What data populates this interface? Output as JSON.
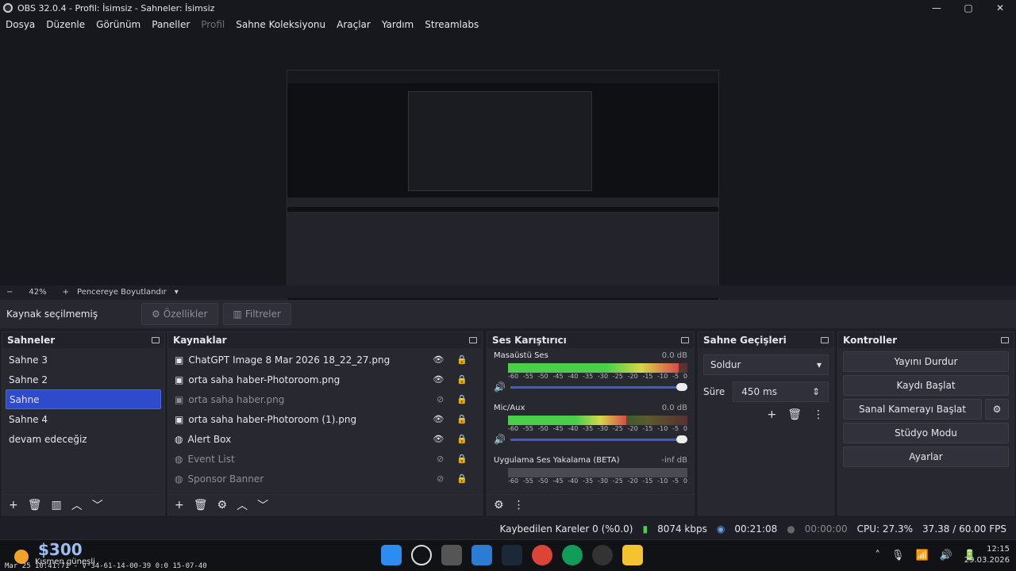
{
  "window": {
    "title": "OBS 32.0.4 - Profil: İsimsiz - Sahneler: İsimsiz",
    "controls": [
      "—",
      "▢",
      "✕"
    ]
  },
  "menu": [
    {
      "label": "Dosya",
      "enabled": true
    },
    {
      "label": "Düzenle",
      "enabled": true
    },
    {
      "label": "Görünüm",
      "enabled": true
    },
    {
      "label": "Paneller",
      "enabled": true
    },
    {
      "label": "Profil",
      "enabled": false
    },
    {
      "label": "Sahne Koleksiyonu",
      "enabled": true
    },
    {
      "label": "Araçlar",
      "enabled": true
    },
    {
      "label": "Yardım",
      "enabled": true
    },
    {
      "label": "Streamlabs",
      "enabled": true
    }
  ],
  "zoom": {
    "minus": "−",
    "value": "42%",
    "plus": "+",
    "fit_label": "Pencereye Boyutlandır"
  },
  "source_bar": {
    "label": "Kaynak seçilmemiş",
    "properties": "Özellikler",
    "filters": "Filtreler"
  },
  "scenes": {
    "title": "Sahneler",
    "items": [
      "Sahne 3",
      "Sahne 2",
      "Sahne",
      "Sahne 4",
      "devam edeceğiz"
    ],
    "selected": 2
  },
  "sources": {
    "title": "Kaynaklar",
    "items": [
      {
        "name": "ChatGPT Image 8 Mar 2026 18_22_27.png",
        "visible": true
      },
      {
        "name": "orta saha haber-Photoroom.png",
        "visible": true
      },
      {
        "name": "orta saha haber.png",
        "visible": false
      },
      {
        "name": "orta saha haber-Photoroom (1).png",
        "visible": true
      },
      {
        "name": "Alert Box",
        "visible": true
      },
      {
        "name": "Event List",
        "visible": false
      },
      {
        "name": "Sponsor Banner",
        "visible": false
      }
    ]
  },
  "mixer": {
    "title": "Ses Karıştırıcı",
    "channels": [
      {
        "name": "Masaüstü Ses",
        "db": "0.0 dB",
        "level": 0.95
      },
      {
        "name": "Mic/Aux",
        "db": "0.0 dB",
        "level": 0.66
      },
      {
        "name": "Uygulama Ses Yakalama (BETA)",
        "db": "-inf dB",
        "level": 0.0
      }
    ],
    "scale": [
      "-60",
      "-55",
      "-50",
      "-45",
      "-40",
      "-35",
      "-30",
      "-25",
      "-20",
      "-15",
      "-10",
      "-5",
      "0"
    ]
  },
  "transitions": {
    "title": "Sahne Geçişleri",
    "selected": "Soldur",
    "duration_label": "Süre",
    "duration": "450 ms"
  },
  "controls": {
    "title": "Kontroller",
    "stop_stream": "Yayını Durdur",
    "start_record": "Kaydı Başlat",
    "virtual_cam": "Sanal Kamerayı Başlat",
    "studio": "Stüdyo Modu",
    "settings": "Ayarlar"
  },
  "status": {
    "dropped": "Kaybedilen Kareler 0 (%0.0)",
    "bitrate": "8074 kbps",
    "stream_time": "00:21:08",
    "rec_time": "00:00:00",
    "cpu": "CPU: 27.3%",
    "fps": "37.38 / 60.00 FPS"
  },
  "taskbar": {
    "overlay_amount": "$300",
    "weather": "Kısmen güneşli",
    "ticker": "Mar 25 10:41:71 - V 34-61-14-00-39 0:0 15-07-40",
    "time": "12:15",
    "date": "29.03.2026"
  }
}
